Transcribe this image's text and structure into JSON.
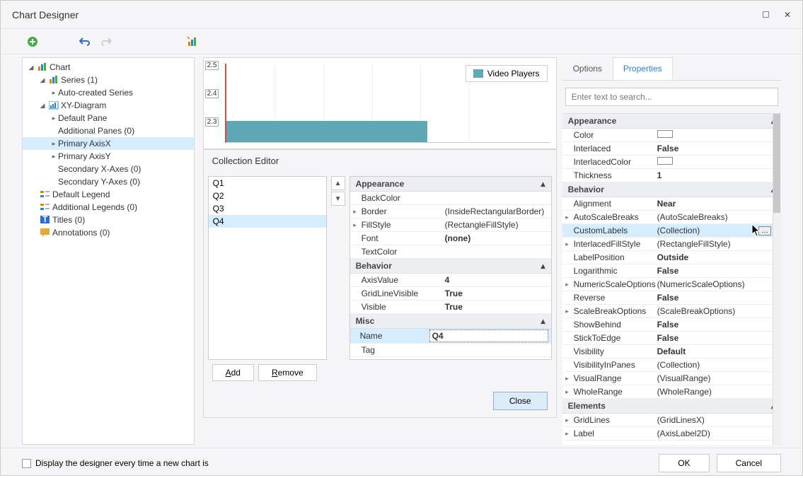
{
  "window": {
    "title": "Chart Designer"
  },
  "toolbar": {},
  "tree": {
    "chart": "Chart",
    "series": "Series (1)",
    "autocreated": "Auto-created Series",
    "xydiagram": "XY-Diagram",
    "defaultpane": "Default Pane",
    "addlpanes": "Additional Panes (0)",
    "primaryx": "Primary AxisX",
    "primaryy": "Primary AxisY",
    "secx": "Secondary X-Axes (0)",
    "secy": "Secondary Y-Axes (0)",
    "deflegend": "Default Legend",
    "addllegends": "Additional Legends (0)",
    "titles": "Titles (0)",
    "annotations": "Annotations (0)"
  },
  "legend": {
    "label": "Video Players"
  },
  "yt": {
    "a": "2.5",
    "b": "2.4",
    "c": "2.3"
  },
  "colleditor": {
    "title": "Collection Editor",
    "items": [
      "Q1",
      "Q2",
      "Q3",
      "Q4"
    ],
    "selected_index": 3,
    "add": "Add",
    "remove": "Remove",
    "close": "Close",
    "props": {
      "cat_appearance": "Appearance",
      "backcolor": "BackColor",
      "border": "Border",
      "border_v": "(InsideRectangularBorder)",
      "fillstyle": "FillStyle",
      "fillstyle_v": "(RectangleFillStyle)",
      "font": "Font",
      "font_v": "(none)",
      "textcolor": "TextColor",
      "cat_behavior": "Behavior",
      "axisvalue": "AxisValue",
      "axisvalue_v": "4",
      "gridline": "GridLineVisible",
      "gridline_v": "True",
      "visible": "Visible",
      "visible_v": "True",
      "cat_misc": "Misc",
      "name": "Name",
      "name_v": "Q4",
      "tag": "Tag"
    }
  },
  "tabs": {
    "options": "Options",
    "properties": "Properties"
  },
  "search": {
    "placeholder": "Enter text to search..."
  },
  "props": {
    "cat_appearance": "Appearance",
    "color": "Color",
    "interlaced": "Interlaced",
    "interlaced_v": "False",
    "interlacedcolor": "InterlacedColor",
    "thickness": "Thickness",
    "thickness_v": "1",
    "cat_behavior": "Behavior",
    "alignment": "Alignment",
    "alignment_v": "Near",
    "autoscale": "AutoScaleBreaks",
    "autoscale_v": "(AutoScaleBreaks)",
    "customlabels": "CustomLabels",
    "customlabels_v": "(Collection)",
    "interlacedfs": "InterlacedFillStyle",
    "interlacedfs_v": "(RectangleFillStyle)",
    "labelpos": "LabelPosition",
    "labelpos_v": "Outside",
    "logarithmic": "Logarithmic",
    "logarithmic_v": "False",
    "numscale": "NumericScaleOptions",
    "numscale_v": "(NumericScaleOptions)",
    "reverse": "Reverse",
    "reverse_v": "False",
    "scalebreak": "ScaleBreakOptions",
    "scalebreak_v": "(ScaleBreakOptions)",
    "showbehind": "ShowBehind",
    "showbehind_v": "False",
    "sticktoedge": "StickToEdge",
    "sticktoedge_v": "False",
    "visibility": "Visibility",
    "visibility_v": "Default",
    "visinpanes": "VisibilityInPanes",
    "visinpanes_v": "(Collection)",
    "visualrange": "VisualRange",
    "visualrange_v": "(VisualRange)",
    "wholerange": "WholeRange",
    "wholerange_v": "(WholeRange)",
    "cat_elements": "Elements",
    "gridlines": "GridLines",
    "gridlines_v": "(GridLinesX)",
    "label": "Label",
    "label_v": "(AxisLabel2D)"
  },
  "footer": {
    "checkbox": "Display the designer every time a new chart is",
    "ok": "OK",
    "cancel": "Cancel"
  }
}
